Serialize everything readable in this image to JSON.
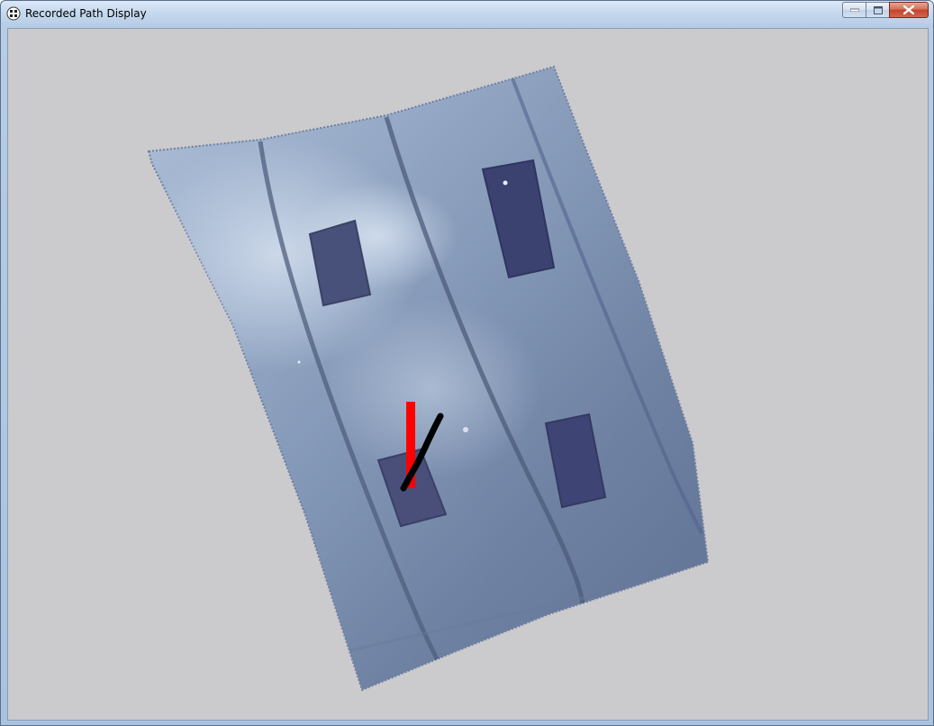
{
  "window": {
    "title": "Recorded Path Display",
    "app_icon": "app-icon",
    "buttons": {
      "minimize_icon": "minimize-icon",
      "maximize_icon": "maximize-icon",
      "close_icon": "close-icon"
    }
  },
  "colors": {
    "client_background": "#cbcacd",
    "recorded_path": "#ff0000",
    "current_path": "#000000",
    "floor_image_tint": "#7d8fae"
  }
}
